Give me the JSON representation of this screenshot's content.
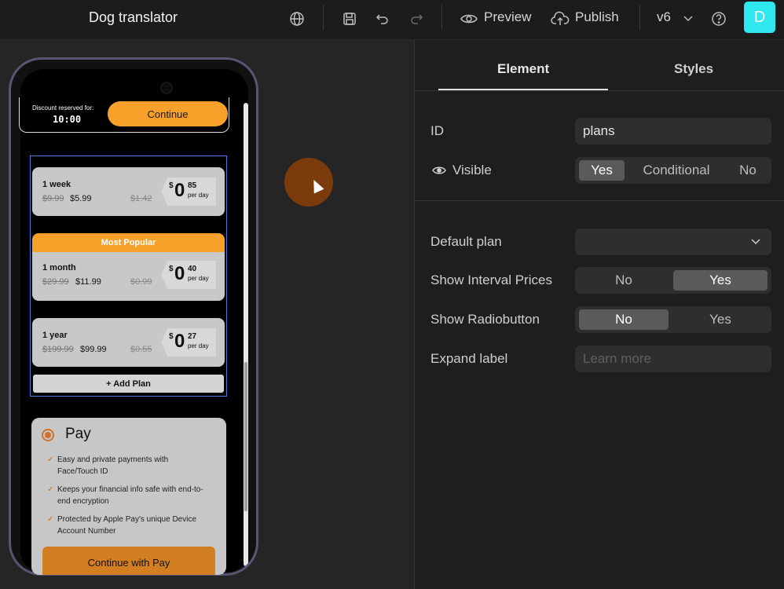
{
  "toolbar": {
    "title": "Dog translator",
    "preview_label": "Preview",
    "publish_label": "Publish",
    "version": "v6",
    "avatar_letter": "D"
  },
  "phone": {
    "discount_label": "Discount reserved for:",
    "timer": "10:00",
    "continue_label": "Continue",
    "popular_label": "Most Popular",
    "add_plan_label": "+ Add Plan",
    "plans": [
      {
        "name": "1 week",
        "old_price": "$9.99",
        "new_price": "$5.99",
        "old_daily": "$1.42",
        "cur": "$",
        "int": "0",
        "dec": "85",
        "per": "per day"
      },
      {
        "name": "1 month",
        "old_price": "$29.99",
        "new_price": "$11.99",
        "old_daily": "$0.99",
        "cur": "$",
        "int": "0",
        "dec": "40",
        "per": "per day"
      },
      {
        "name": "1 year",
        "old_price": "$199.99",
        "new_price": "$99.99",
        "old_daily": "$0.55",
        "cur": "$",
        "int": "0",
        "dec": "27",
        "per": "per day"
      }
    ],
    "payment": {
      "logo": " Pay",
      "features": [
        "Easy and private payments with Face/Touch ID",
        "Keeps your financial info safe with end-to-end encryption",
        "Protected by Apple Pay's unique Device Account Number"
      ],
      "button_label": "Continue with  Pay"
    }
  },
  "panel": {
    "tabs": [
      "Element",
      "Styles"
    ],
    "id_label": "ID",
    "id_value": "plans",
    "visible_label": "Visible",
    "visible_options": [
      "Yes",
      "Conditional",
      "No"
    ],
    "default_plan_label": "Default plan",
    "interval_label": "Show Interval Prices",
    "interval_options": [
      "No",
      "Yes"
    ],
    "radio_label": "Show Radiobutton",
    "radio_options": [
      "No",
      "Yes"
    ],
    "expand_label": "Expand label",
    "expand_placeholder": "Learn more"
  },
  "colors": {
    "accent": "#f7a12b",
    "avatar": "#2fe7ee",
    "selection": "#4f7ae0"
  }
}
